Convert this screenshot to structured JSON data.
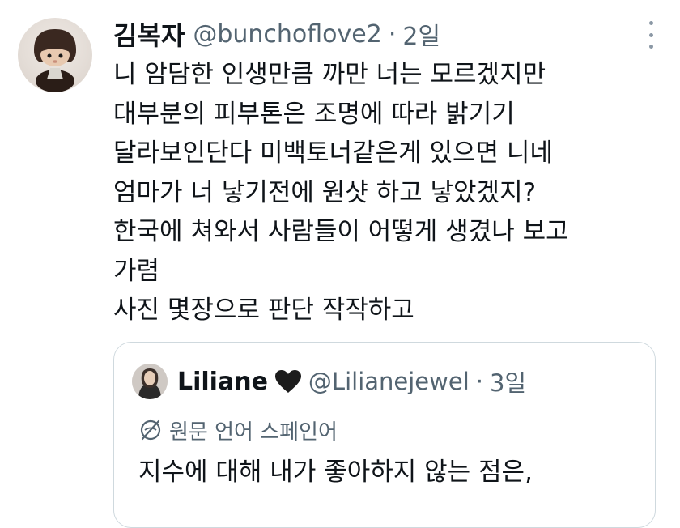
{
  "tweet": {
    "display_name": "김복자",
    "handle": "@bunchoflove2",
    "separator": "·",
    "time": "2일",
    "lines": [
      "니 암담한 인생만큼 까만 너는 모르겠지만",
      "대부분의 피부톤은 조명에 따라 밝기기",
      "달라보인단다 미백토너같은게 있으면 니네",
      "엄마가 너 낳기전에 원샷 하고 낳았겠지?",
      "한국에 쳐와서 사람들이 어떻게 생겼나 보고",
      "가렴",
      "사진 몇장으로 판단 작작하고"
    ]
  },
  "quote": {
    "display_name": "Liliane",
    "handle": "@Lilianejewel",
    "separator": "·",
    "time": "3일",
    "translate_label": "원문 언어 스페인어",
    "text": "지수에 대해 내가 좋아하지 않는 점은,"
  },
  "icons": {
    "avatar": "plush-doll-avatar",
    "more": "more-options-icon",
    "heart": "black-heart-icon",
    "translate": "translate-globe-icon"
  },
  "colors": {
    "text_primary": "#0f1419",
    "text_secondary": "#536471",
    "border": "#cfd9de"
  }
}
